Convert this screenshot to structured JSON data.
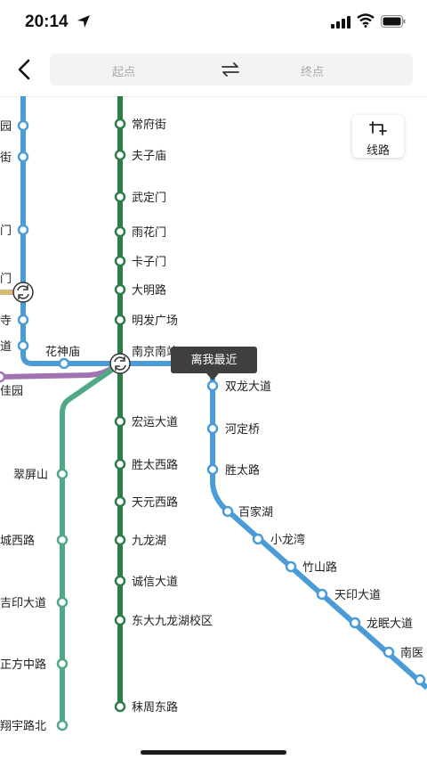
{
  "status_bar": {
    "time": "20:14"
  },
  "nav": {
    "start_placeholder": "起点",
    "end_placeholder": "终点"
  },
  "lines_button": {
    "label": "线路"
  },
  "tooltip": {
    "text": "离我最近"
  },
  "colors": {
    "line_blue": "#4a9bd6",
    "line_dark_green": "#2e7d46",
    "line_teal": "#4fa985",
    "line_purple": "#a173b2",
    "line_tan": "#d9b97a"
  },
  "map": {
    "dark_green_stations": [
      "常府街",
      "夫子庙",
      "武定门",
      "雨花门",
      "卡子门",
      "大明路",
      "明发广场",
      "南京南站",
      "宏运大道",
      "胜太西路",
      "天元西路",
      "九龙湖",
      "诚信大道",
      "东大九龙湖校区",
      "秣周东路"
    ],
    "blue_branch_stations": [
      "双龙大道",
      "河定桥",
      "胜太路",
      "百家湖",
      "小龙湾",
      "竹山路",
      "天印大道",
      "龙眠大道",
      "南医"
    ],
    "left_blue_stations": [
      "园",
      "街",
      "门",
      "门",
      "寺",
      "道"
    ],
    "other_stations": [
      "花神庙",
      "佳园"
    ],
    "teal_stations": [
      "翠屏山",
      "城西路",
      "吉印大道",
      "正方中路",
      "翔宇路北"
    ]
  }
}
